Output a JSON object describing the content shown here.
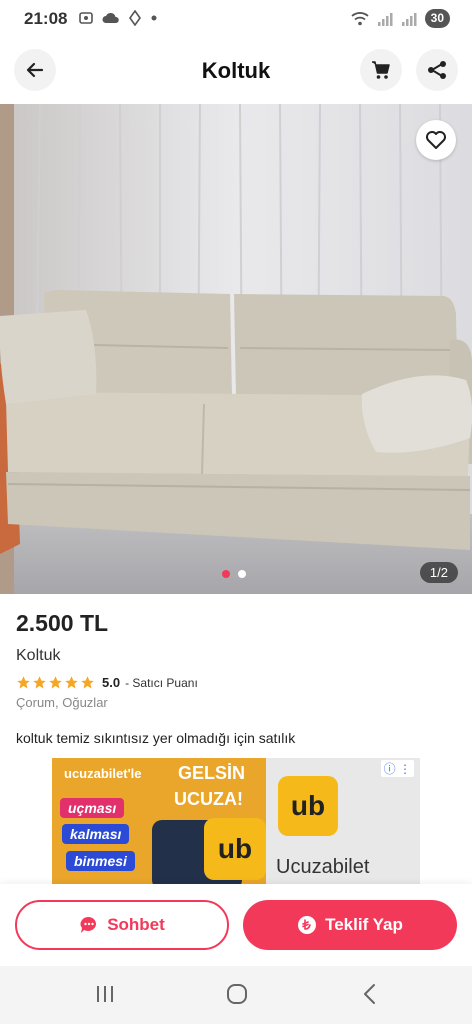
{
  "status_bar": {
    "time": "21:08",
    "battery": "30"
  },
  "header": {
    "title": "Koltuk"
  },
  "photo": {
    "counter": "1/2",
    "dots_total": 2,
    "active_dot": 1
  },
  "listing": {
    "price": "2.500 TL",
    "title": "Koltuk",
    "rating_value": "5.0",
    "rating_label": "- Satıcı Puanı",
    "stars": 5,
    "location": "Çorum, Oğuzlar",
    "description": "koltuk temiz sıkıntısız yer olmadığı için satılık"
  },
  "ad": {
    "brand": "ucuzabilet'le",
    "headline_1": "GELSİN",
    "headline_2": "UCUZA!",
    "pill_1": "uçması",
    "pill_2": "kalması",
    "pill_3": "binmesi",
    "logo_text": "ub",
    "brand_name": "Ucuzabilet",
    "info_label": "ⓘ ⋮"
  },
  "actions": {
    "chat_label": "Sohbet",
    "offer_label": "Teklif Yap"
  },
  "colors": {
    "accent": "#f2395a",
    "star": "#f5a623"
  }
}
